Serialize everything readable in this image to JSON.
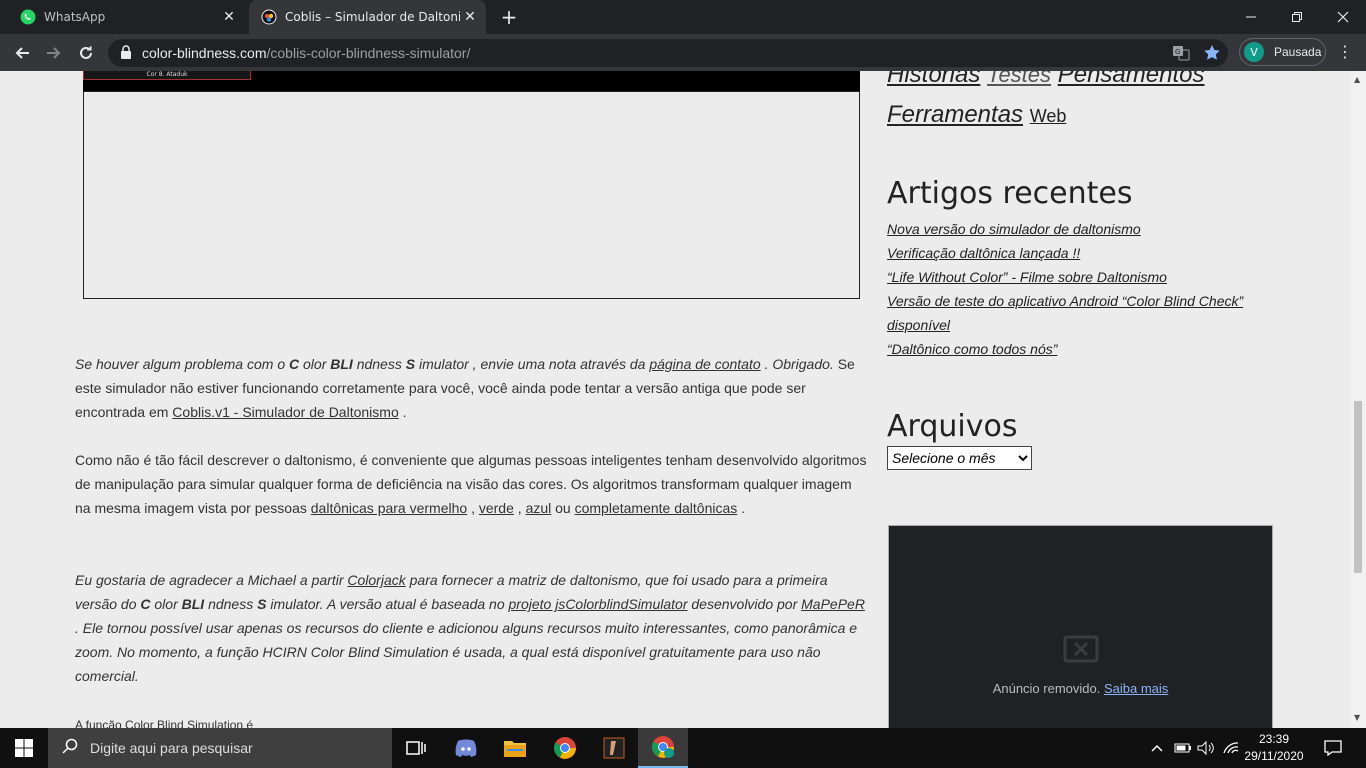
{
  "browser": {
    "tabs": [
      {
        "title": "WhatsApp",
        "active": false
      },
      {
        "title": "Coblis – Simulador de Daltonismo",
        "active": true
      }
    ],
    "url_host": "color-blindness.com",
    "url_path": "/coblis-color-blindness-simulator/",
    "profile_initial": "V",
    "profile_status": "Pausada",
    "accent_color": "#0f9d8a"
  },
  "demo": {
    "inner_label": "Cor 8. Ataduk"
  },
  "article": {
    "p1": {
      "t1": "Se houver algum problema com o ",
      "c": "C",
      "t2": " olor ",
      "bli": "BLI",
      "t3": " ndness ",
      "s": "S",
      "t4": " imulator , envie uma nota através da ",
      "link_contact": "página de contato",
      "t5": " . Obrigado.",
      "t6": " Se este simulador não estiver funcionando corretamente para você, você ainda pode tentar a versão antiga que pode ser encontrada em ",
      "link_v1": "Coblis.v1 - Simulador de Daltonismo",
      "t7": " ."
    },
    "p2": {
      "t1": "Como não é tão fácil descrever o daltonismo, é conveniente que algumas pessoas inteligentes tenham desenvolvido algoritmos de manipulação para simular qualquer forma de deficiência na visão das cores. Os algoritmos transformam qualquer imagem na mesma imagem vista por pessoas ",
      "link_red": "daltônicas para vermelho",
      "t2": " , ",
      "link_green": "verde",
      "t3": " , ",
      "link_blue": "azul",
      "t4": " ou ",
      "link_total": "completamente daltônicas",
      "t5": " ."
    },
    "p3": {
      "t1": "Eu gostaria de agradecer a Michael a partir ",
      "link_colorjack": "Colorjack",
      "t2": " para fornecer a matriz de daltonismo, que foi usado para a primeira versão do ",
      "c": "C",
      "t3": " olor ",
      "bli": "BLI",
      "t4": " ndness ",
      "s": "S",
      "t5": " imulator. A versão atual é baseada no ",
      "link_project": "projeto jsColorblindSimulator",
      "t6": " desenvolvido por ",
      "link_mapeper": "MaPePeR",
      "t7": " . Ele tornou possível usar apenas os recursos do cliente e adicionou alguns recursos muito interessantes, como panorâmica e zoom. No momento, a função HCIRN Color Blind Simulation é usada, a qual está disponível gratuitamente para uso não comercial."
    },
    "p4_partial": "A função Color Blind Simulation é"
  },
  "sidebar": {
    "categories_line1": [
      "Histórias",
      "Testes",
      "Pensamentos"
    ],
    "categories_line2": [
      "Ferramentas",
      "Web"
    ],
    "recent_heading": "Artigos recentes",
    "recent_posts": [
      "Nova versão do simulador de daltonismo",
      "Verificação daltônica lançada !!",
      "“Life Without Color” - Filme sobre Daltonismo",
      "Versão de teste do aplicativo Android “Color Blind Check” disponível",
      "“Daltônico como todos nós”"
    ],
    "archive_heading": "Arquivos",
    "archive_select": "Selecione o mês",
    "ad_text": "Anúncio removido.",
    "ad_link": "Saiba mais"
  },
  "taskbar": {
    "search_placeholder": "Digite aqui para pesquisar",
    "time": "23:39",
    "date": "29/11/2020"
  }
}
